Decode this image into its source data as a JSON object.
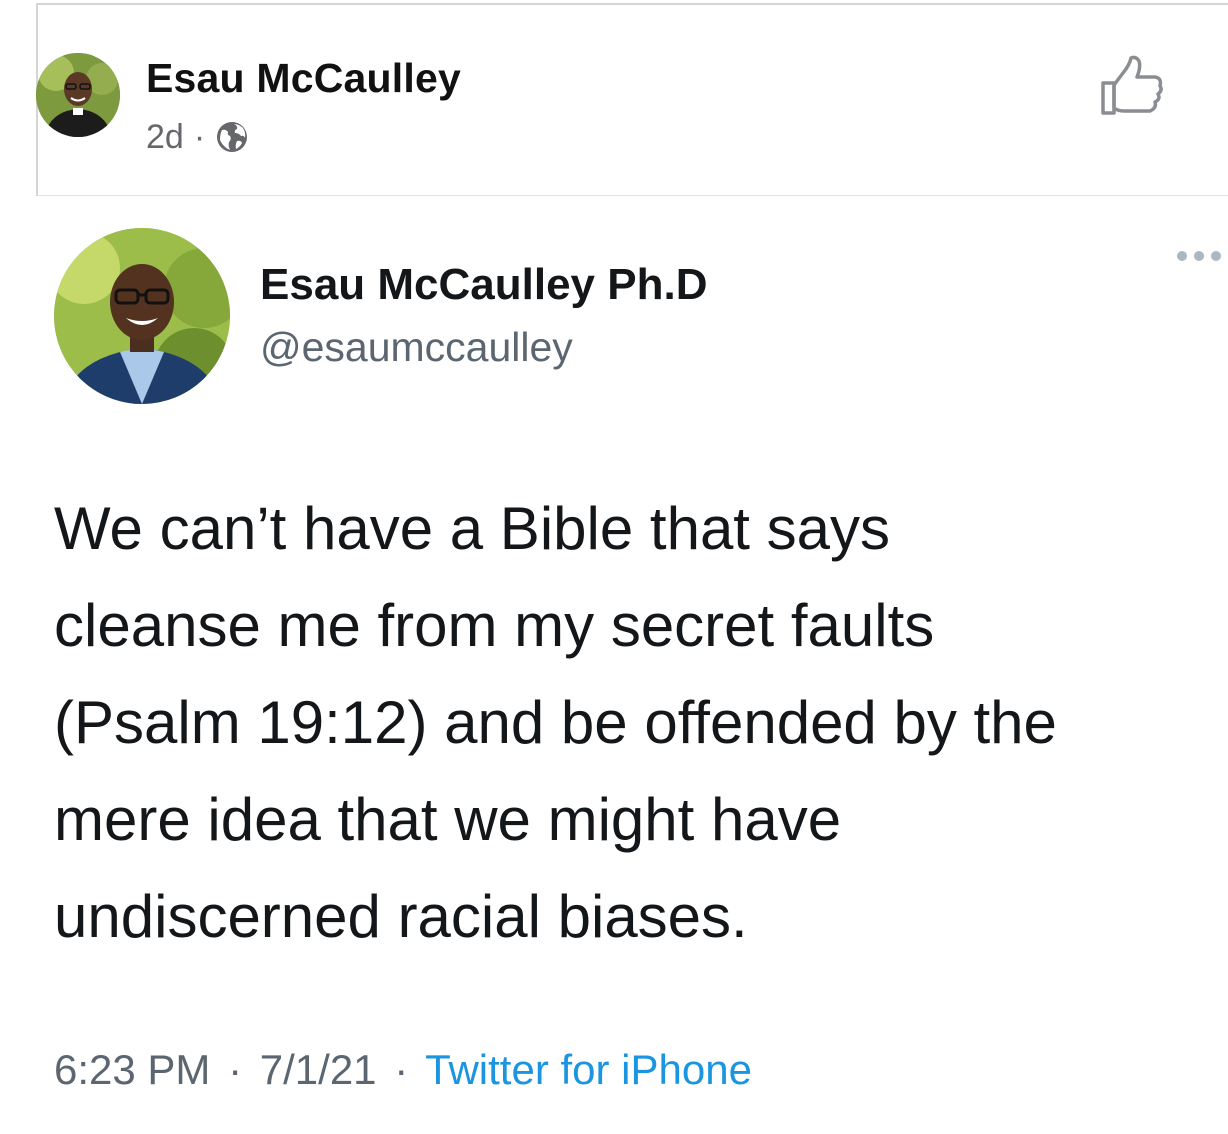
{
  "facebook_post": {
    "author_name": "Esau McCaulley",
    "age": "2d",
    "separator": "·",
    "audience_icon": "globe-icon",
    "like_icon": "thumbs-up-icon",
    "avatar": "profile-photo"
  },
  "tweet": {
    "display_name": "Esau McCaulley Ph.D",
    "handle": "@esaumccaulley",
    "more_icon": "more-dots-icon",
    "text_lines": [
      "We can’t have a Bible that says",
      "cleanse me from my secret faults",
      "(Psalm 19:12) and be offended by the",
      "mere idea that we might have",
      "undiscerned racial biases."
    ],
    "time": "6:23 PM",
    "date": "7/1/21",
    "separator": "·",
    "source": "Twitter for iPhone",
    "colors": {
      "source_link": "#1b95e0",
      "secondary_text": "#5b6670"
    }
  }
}
